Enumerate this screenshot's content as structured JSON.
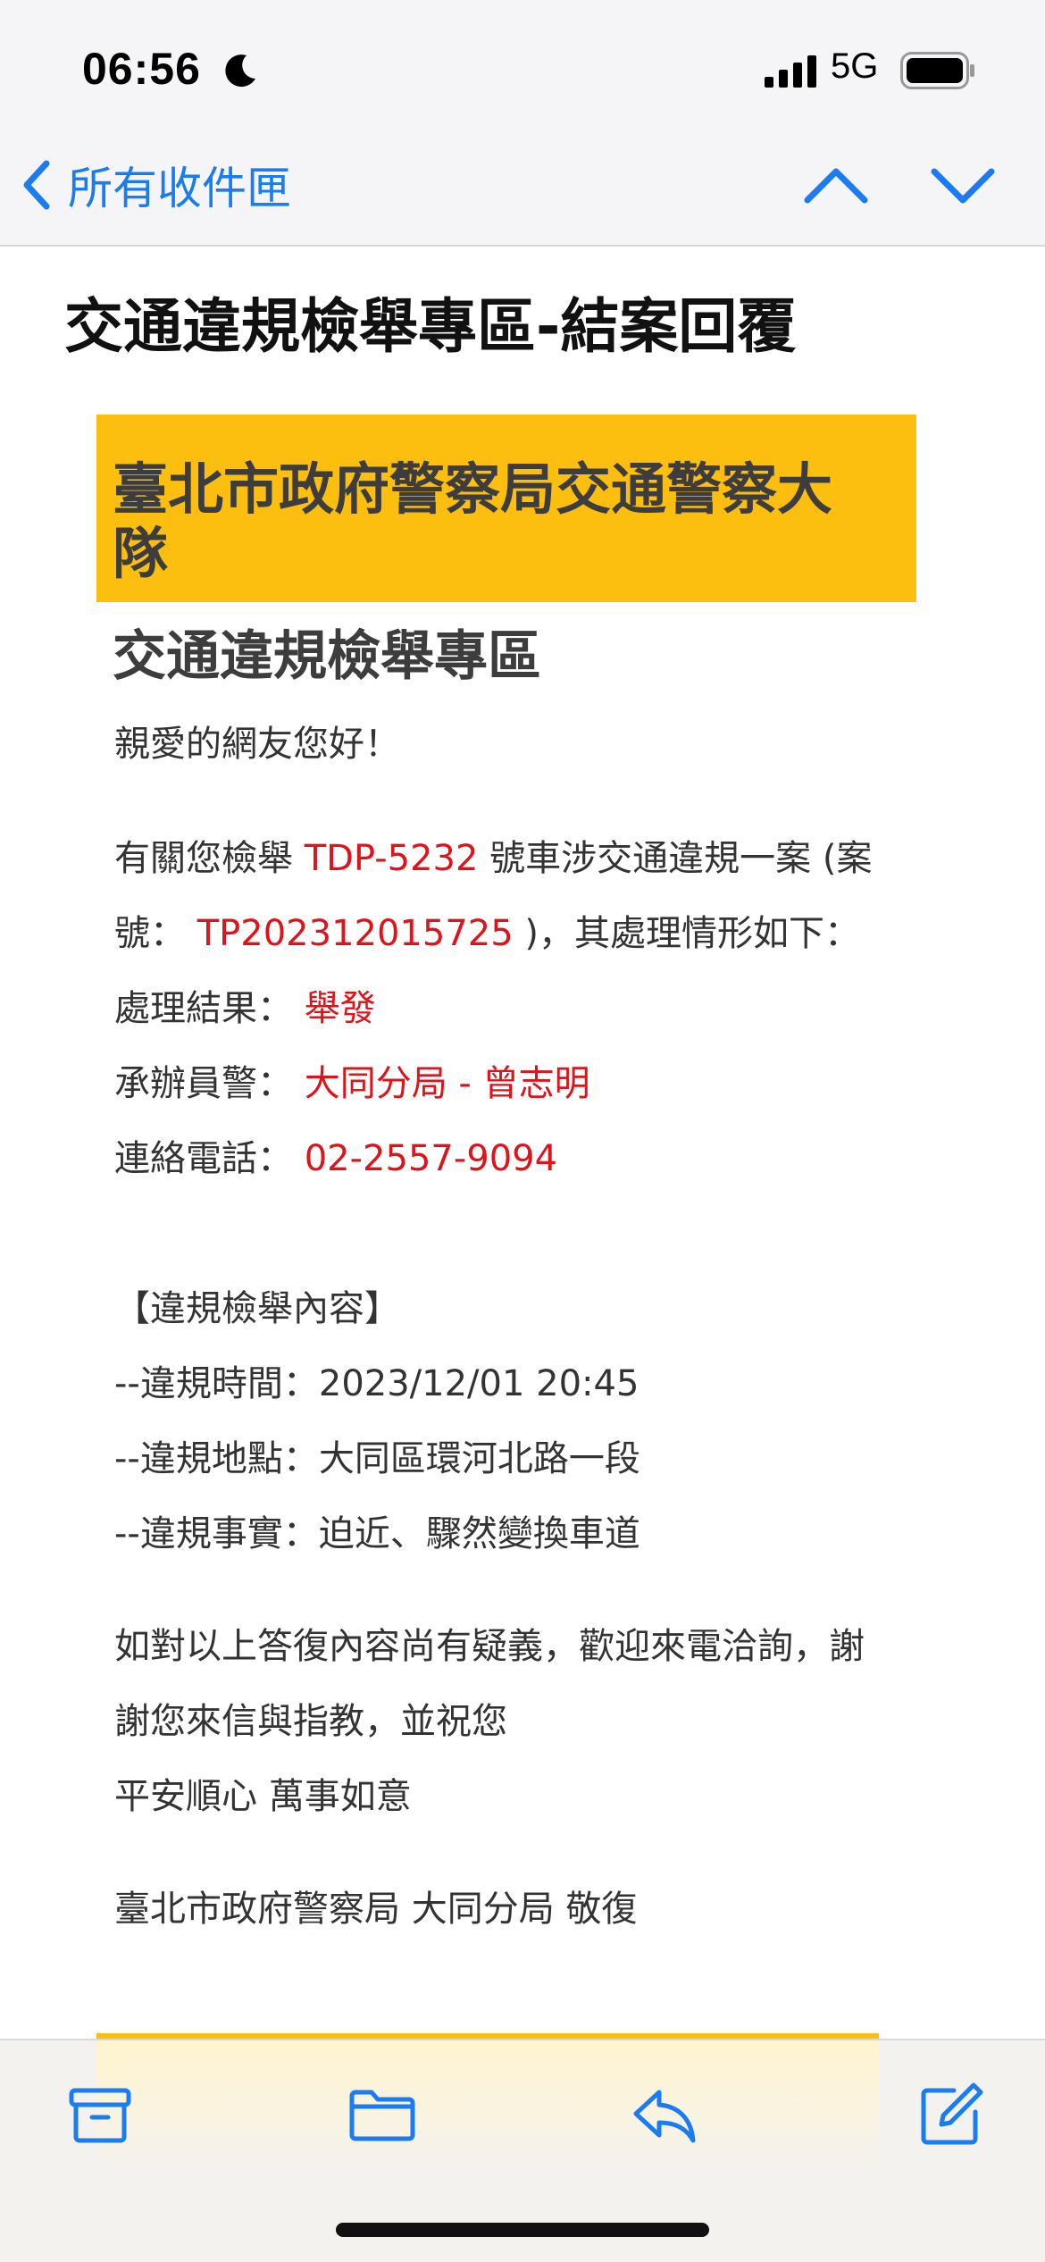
{
  "status_bar": {
    "time": "06:56",
    "network": "5G",
    "icons": [
      "moon-icon",
      "signal-icon",
      "battery-icon"
    ]
  },
  "nav": {
    "back_label": "所有收件匣",
    "icons": [
      "back-chevron-icon",
      "chevron-up-icon",
      "chevron-down-icon"
    ]
  },
  "email": {
    "subject": "交通違規檢舉專區-結案回覆",
    "banner_line1": "臺北市政府警察局交通警察大",
    "banner_line2": "隊",
    "section_title": "交通違規檢舉專區",
    "greeting": "親愛的網友您好！",
    "p1_pre": "有關您檢舉",
    "plate": "TDP-5232",
    "p1_post": "號車涉交通違規一案 (案",
    "p2_pre": "號：",
    "case_no": "TP202312015725",
    "p2_post": ")，其處理情形如下：",
    "result_label": "處理結果：",
    "result_value": "舉發",
    "officer_label": "承辦員警：",
    "officer_value": "大同分局 - 曾志明",
    "phone_label": "連絡電話：",
    "phone_value": "02-2557-9094",
    "content_heading": "【違規檢舉內容】",
    "violation_time": "--違規時間：2023/12/01 20:45",
    "violation_place": "--違規地點：大同區環河北路一段",
    "violation_fact": "--違規事實：迫近、驟然變換車道",
    "closing_line1": "如對以上答復內容尚有疑義，歡迎來電洽詢，謝",
    "closing_line2": "謝您來信與指教，並祝您",
    "closing_line3": "平安順心 萬事如意",
    "signature": "臺北市政府警察局 大同分局 敬復"
  },
  "toolbar": {
    "icons": [
      "archive-icon",
      "folder-icon",
      "reply-icon",
      "compose-icon"
    ]
  },
  "colors": {
    "accent_blue": "#1a7cf0",
    "banner_yellow": "#fcbf0f",
    "highlight_red": "#e0131a"
  }
}
